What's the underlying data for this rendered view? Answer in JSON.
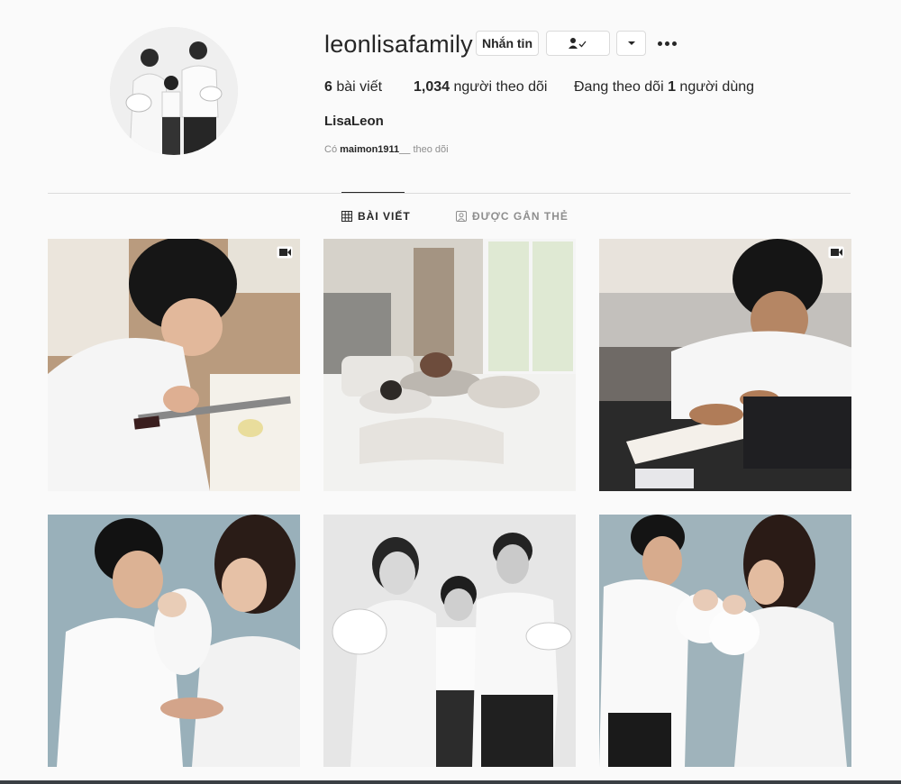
{
  "profile": {
    "username": "leonlisafamily",
    "full_name": "LisaLeon",
    "buttons": {
      "message": "Nhắn tin",
      "follow_icon": "person-check-icon",
      "dropdown_icon": "caret-down-icon",
      "more_icon": "more-options-icon"
    },
    "stats": {
      "posts_count": "6",
      "posts_label": " bài viết",
      "followers_count": "1,034",
      "followers_label": " người theo dõi",
      "following_prefix": "Đang theo dõi ",
      "following_count": "1",
      "following_label": " người dùng"
    },
    "followed_by": {
      "prefix": "Có ",
      "user": "maimon1911__",
      "suffix": " theo dõi"
    }
  },
  "tabs": [
    {
      "label": "BÀI VIẾT",
      "icon": "grid-icon",
      "active": true
    },
    {
      "label": "ĐƯỢC GẮN THẺ",
      "icon": "tagged-icon",
      "active": false
    }
  ],
  "posts": [
    {
      "description": "boy-cutting-fruit",
      "type": "video"
    },
    {
      "description": "family-resting-on-bed",
      "type": "photo"
    },
    {
      "description": "boy-writing-card",
      "type": "video"
    },
    {
      "description": "father-kissing-baby",
      "type": "photo"
    },
    {
      "description": "family-portrait-bw",
      "type": "photo"
    },
    {
      "description": "parents-holding-twins",
      "type": "photo"
    }
  ],
  "colors": {
    "background": "#fafafa",
    "text": "#262626",
    "muted": "#8e8e8e",
    "border": "#dbdbdb"
  }
}
